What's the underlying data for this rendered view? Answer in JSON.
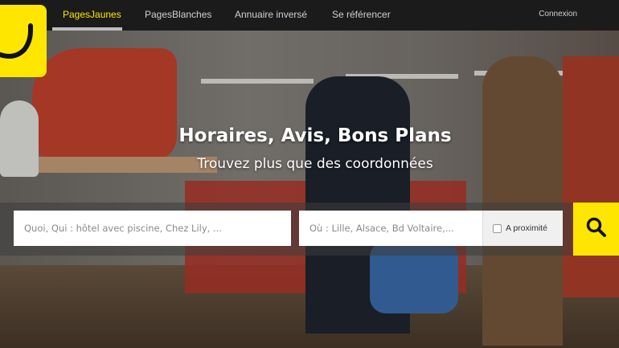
{
  "nav": {
    "items": [
      {
        "label": "PagesJaunes",
        "active": true
      },
      {
        "label": "PagesBlanches",
        "active": false
      },
      {
        "label": "Annuaire inversé",
        "active": false
      },
      {
        "label": "Se référencer",
        "active": false
      }
    ],
    "login_label": "Connexion"
  },
  "hero": {
    "title": "Horaires, Avis, Bons Plans",
    "subtitle": "Trouvez plus que des coordonnées"
  },
  "search": {
    "what_placeholder": "Quoi, Qui : hôtel avec piscine, Chez Lily, ...",
    "what_value": "",
    "where_placeholder": "Où : Lille, Alsace, Bd Voltaire,...",
    "where_value": "",
    "proximity_label": "A proximité",
    "proximity_checked": false
  },
  "colors": {
    "brand_yellow": "#ffe600",
    "topbar": "#1b1b1b"
  },
  "icons": {
    "logo": "pagesjaunes-logo",
    "search": "search-icon"
  }
}
